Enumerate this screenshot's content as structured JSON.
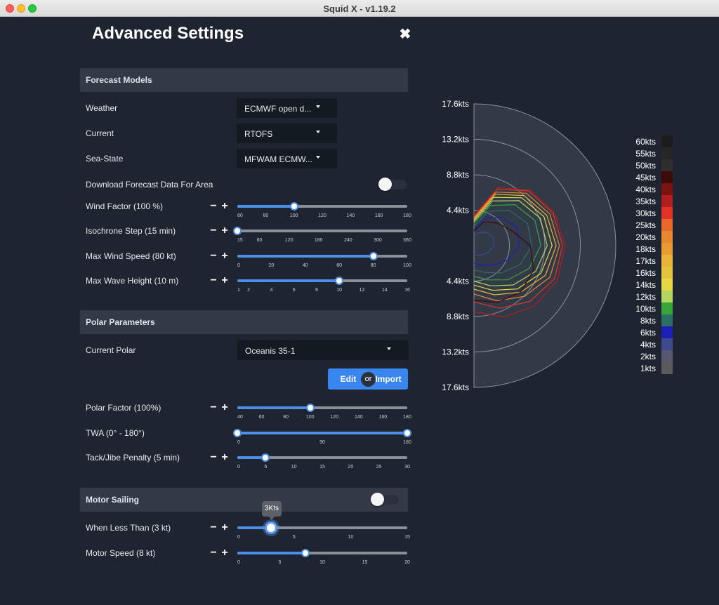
{
  "window": {
    "title": "Squid X - v1.19.2"
  },
  "settings": {
    "title": "Advanced Settings",
    "close_icon": "close-icon"
  },
  "forecast_models": {
    "title": "Forecast Models",
    "weather": {
      "label": "Weather",
      "value": "ECMWF open d..."
    },
    "current": {
      "label": "Current",
      "value": "RTOFS"
    },
    "sea_state": {
      "label": "Sea-State",
      "value": "MFWAM ECMW..."
    },
    "download": {
      "label": "Download Forecast Data For Area",
      "enabled": false
    }
  },
  "sliders": {
    "wind_factor": {
      "label": "Wind Factor (100 %)",
      "min": 60,
      "max": 180,
      "value": 100,
      "ticks": [
        "60",
        "80",
        "100",
        "120",
        "140",
        "160",
        "180"
      ]
    },
    "isochrone_step": {
      "label": "Isochrone Step (15 min)",
      "min": 15,
      "max": 360,
      "value": 15,
      "ticks": [
        "15",
        "60",
        "120",
        "180",
        "240",
        "300",
        "360"
      ]
    },
    "max_wind_speed": {
      "label": "Max Wind Speed (80 kt)",
      "min": 0,
      "max": 100,
      "value": 80,
      "ticks": [
        "0",
        "20",
        "40",
        "60",
        "80",
        "100"
      ]
    },
    "max_wave_height": {
      "label": "Max Wave Height (10 m)",
      "min": 1,
      "max": 16,
      "value": 10,
      "ticks": [
        "1",
        "2",
        "4",
        "6",
        "8",
        "10",
        "12",
        "14",
        "16"
      ]
    },
    "polar_factor": {
      "label": "Polar Factor (100%)",
      "min": 40,
      "max": 180,
      "value": 100,
      "ticks": [
        "40",
        "60",
        "80",
        "100",
        "120",
        "140",
        "160",
        "180"
      ]
    },
    "twa": {
      "label": "TWA (0° - 180°)",
      "min": 0,
      "max": 180,
      "value_low": 0,
      "value_high": 180,
      "ticks": [
        "0",
        "90",
        "180"
      ]
    },
    "tack_jibe": {
      "label": "Tack/Jibe Penalty (5 min)",
      "min": 0,
      "max": 30,
      "value": 5,
      "ticks": [
        "0",
        "5",
        "10",
        "15",
        "20",
        "25",
        "30"
      ]
    },
    "when_less_than": {
      "label": "When Less Than (3 kt)",
      "min": 0,
      "max": 15,
      "value": 3,
      "ticks": [
        "0",
        "5",
        "10",
        "15"
      ],
      "tooltip": "3Kts"
    },
    "motor_speed": {
      "label": "Motor Speed (8 kt)",
      "min": 0,
      "max": 20,
      "value": 8,
      "ticks": [
        "0",
        "5",
        "10",
        "15",
        "20"
      ]
    }
  },
  "polar_parameters": {
    "title": "Polar Parameters",
    "current_polar": {
      "label": "Current Polar",
      "value": "Oceanis 35-1"
    },
    "edit_label": "Edit",
    "or_label": "or",
    "import_label": "Import"
  },
  "motor_sailing": {
    "title": "Motor Sailing",
    "enabled": false
  },
  "chart_data": {
    "type": "polar",
    "radial_labels_top": [
      "17.6kts",
      "13.2kts",
      "8.8kts",
      "4.4kts"
    ],
    "radial_labels_bottom": [
      "4.4kts",
      "8.8kts",
      "13.2kts",
      "17.6kts"
    ],
    "rmax": 17.6,
    "legend": [
      {
        "label": "60kts",
        "color": "#1c1c1c"
      },
      {
        "label": "55kts",
        "color": "#262626"
      },
      {
        "label": "50kts",
        "color": "#2e2e2e"
      },
      {
        "label": "45kts",
        "color": "#3d0a0a"
      },
      {
        "label": "40kts",
        "color": "#7a1212"
      },
      {
        "label": "35kts",
        "color": "#b31d1d"
      },
      {
        "label": "30kts",
        "color": "#e53228"
      },
      {
        "label": "25kts",
        "color": "#e8682a"
      },
      {
        "label": "20kts",
        "color": "#e8882e"
      },
      {
        "label": "18kts",
        "color": "#e89a35"
      },
      {
        "label": "17kts",
        "color": "#e8b43a"
      },
      {
        "label": "16kts",
        "color": "#e6c33e"
      },
      {
        "label": "14kts",
        "color": "#e6d744"
      },
      {
        "label": "12kts",
        "color": "#b3d660"
      },
      {
        "label": "10kts",
        "color": "#3aa63a"
      },
      {
        "label": "8kts",
        "color": "#2b6e62"
      },
      {
        "label": "6kts",
        "color": "#1a1fb8"
      },
      {
        "label": "4kts",
        "color": "#3e4a8c"
      },
      {
        "label": "2kts",
        "color": "#5a5570"
      },
      {
        "label": "1kts",
        "color": "#5a5a5a"
      }
    ],
    "curves": [
      {
        "color": "#3e4a8c",
        "r": [
          1.2,
          1.8,
          2.3,
          2.6,
          2.5,
          2.0,
          1.6,
          1.3,
          1.1
        ]
      },
      {
        "color": "#1a1fb8",
        "r": [
          2.0,
          3.6,
          5.0,
          5.8,
          5.6,
          4.6,
          3.4,
          2.6,
          2.2
        ]
      },
      {
        "color": "#2b6e62",
        "r": [
          2.4,
          4.6,
          6.2,
          7.2,
          7.2,
          6.2,
          4.8,
          3.6,
          3.0
        ]
      },
      {
        "color": "#3aa63a",
        "r": [
          2.8,
          5.4,
          7.2,
          8.2,
          8.3,
          7.4,
          6.0,
          4.6,
          3.8
        ]
      },
      {
        "color": "#b3d660",
        "r": [
          3.0,
          6.0,
          7.9,
          8.9,
          9.1,
          8.3,
          6.9,
          5.4,
          4.4
        ]
      },
      {
        "color": "#e6d744",
        "r": [
          3.2,
          6.5,
          8.4,
          9.4,
          9.7,
          9.0,
          7.6,
          6.0,
          4.9
        ]
      },
      {
        "color": "#e8b43a",
        "r": [
          3.4,
          6.9,
          8.8,
          9.8,
          10.2,
          9.6,
          8.2,
          6.6,
          5.4
        ]
      },
      {
        "color": "#e8882e",
        "r": [
          3.5,
          7.2,
          9.2,
          10.2,
          10.6,
          10.2,
          8.9,
          7.4,
          6.0
        ]
      },
      {
        "color": "#e53228",
        "r": [
          3.6,
          7.6,
          9.6,
          10.6,
          11.0,
          10.8,
          9.8,
          8.4,
          7.0
        ]
      },
      {
        "color": "#b31d1d",
        "r": [
          3.7,
          7.8,
          9.8,
          10.8,
          11.3,
          11.2,
          10.6,
          9.6,
          8.2
        ]
      },
      {
        "color": "#3d0a0a",
        "r": [
          1.8,
          3.2,
          4.0,
          5.0,
          7.0,
          8.0,
          8.2,
          7.6,
          6.8
        ]
      }
    ]
  }
}
